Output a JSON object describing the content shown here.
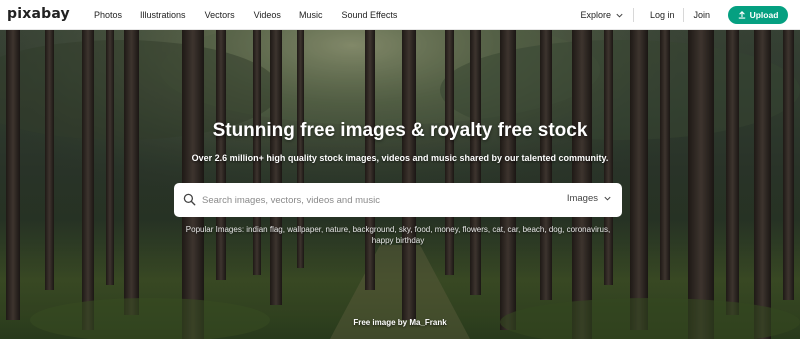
{
  "header": {
    "logo": "pixabay",
    "nav": [
      "Photos",
      "Illustrations",
      "Vectors",
      "Videos",
      "Music",
      "Sound Effects"
    ],
    "explore_label": "Explore",
    "login_label": "Log in",
    "join_label": "Join",
    "upload_label": "Upload"
  },
  "hero": {
    "title": "Stunning free images & royalty free stock",
    "subtitle": "Over 2.6 million+ high quality stock images, videos and music shared by our talented community.",
    "search": {
      "placeholder": "Search images, vectors, videos and music",
      "type_label": "Images"
    },
    "popular": "Popular Images: indian flag, wallpaper, nature, background, sky, food, money, flowers, cat, car, beach, dog, coronavirus, happy birthday",
    "credit": "Free image by Ma_Frank"
  },
  "colors": {
    "accent": "#05a081",
    "header_bg": "#ffffff",
    "text": "#222222"
  },
  "icons": [
    "upload-icon",
    "search-icon",
    "chevron-down-icon"
  ]
}
